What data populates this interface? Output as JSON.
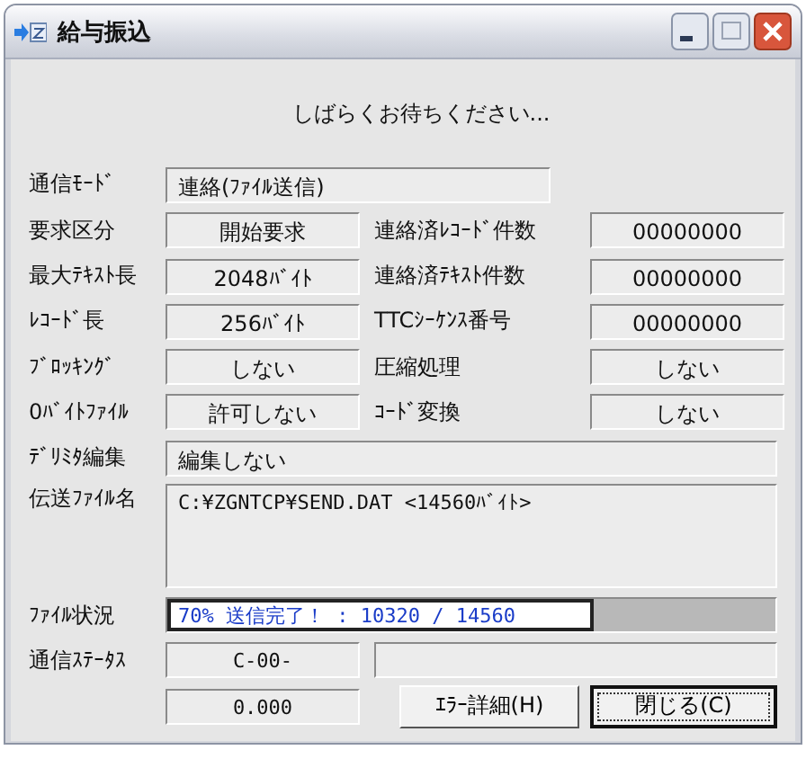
{
  "window": {
    "title": "給与振込"
  },
  "message": "しばらくお待ちください...",
  "mode": {
    "label": "通信ﾓｰﾄﾞ",
    "value": "連絡(ﾌｧｲﾙ送信)"
  },
  "rows": [
    {
      "left": {
        "label": "要求区分",
        "value": "開始要求"
      },
      "right": {
        "label": "連絡済ﾚｺｰﾄﾞ件数",
        "value": "00000000"
      }
    },
    {
      "left": {
        "label": "最大ﾃｷｽﾄ長",
        "value": "2048ﾊﾞｲﾄ"
      },
      "right": {
        "label": "連絡済ﾃｷｽﾄ件数",
        "value": "00000000"
      }
    },
    {
      "left": {
        "label": "ﾚｺｰﾄﾞ長",
        "value": "256ﾊﾞｲﾄ"
      },
      "right": {
        "label": "TTCｼｰｹﾝｽ番号",
        "value": "00000000"
      }
    },
    {
      "left": {
        "label": "ﾌﾞﾛｯｷﾝｸﾞ",
        "value": "しない"
      },
      "right": {
        "label": "圧縮処理",
        "value": "しない"
      }
    },
    {
      "left": {
        "label": "0ﾊﾞｲﾄﾌｧｲﾙ",
        "value": "許可しない"
      },
      "right": {
        "label": "ｺｰﾄﾞ変換",
        "value": "しない"
      }
    }
  ],
  "delimiter": {
    "label": "ﾃﾞﾘﾐﾀ編集",
    "value": "編集しない"
  },
  "file_name": {
    "label": "伝送ﾌｧｲﾙ名",
    "value": "C:¥ZGNTCP¥SEND.DAT <14560ﾊﾞｲﾄ>"
  },
  "file_status": {
    "label": "ﾌｧｲﾙ状況",
    "text": "70% 送信完了！ : 10320 / 14560",
    "level": 0.7
  },
  "comm_status": {
    "label": "通信ｽﾃｰﾀｽ",
    "value": "C-00-"
  },
  "elapsed": "0.000",
  "buttons": [
    {
      "label": "ｴﾗｰ詳細(H)",
      "focused": false
    },
    {
      "label": "閉じる(C)",
      "focused": true
    }
  ]
}
